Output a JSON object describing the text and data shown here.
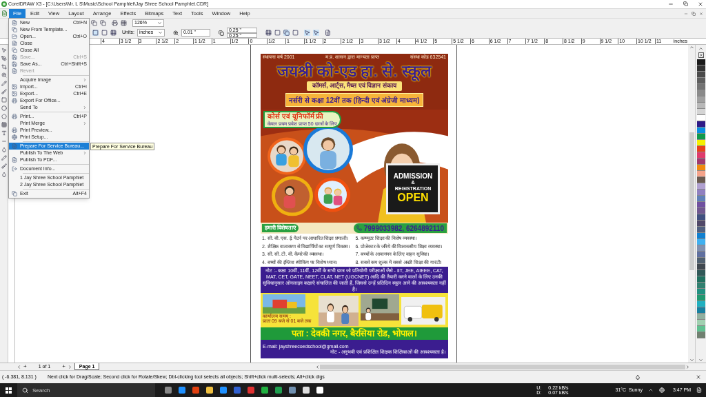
{
  "window": {
    "title": "CorelDRAW X3 - [C:\\Users\\Mr. L S\\Music\\School Pamphlet\\Jay Shree School Pamphlet.CDR]"
  },
  "menu_bar": [
    {
      "label": "File",
      "selected": true
    },
    {
      "label": "Edit",
      "selected": false
    },
    {
      "label": "View",
      "selected": false
    },
    {
      "label": "Layout",
      "selected": false
    },
    {
      "label": "Arrange",
      "selected": false
    },
    {
      "label": "Effects",
      "selected": false
    },
    {
      "label": "Bitmaps",
      "selected": false
    },
    {
      "label": "Text",
      "selected": false
    },
    {
      "label": "Tools",
      "selected": false
    },
    {
      "label": "Window",
      "selected": false
    },
    {
      "label": "Help",
      "selected": false
    }
  ],
  "file_menu": [
    {
      "kind": "item",
      "label": "New",
      "shortcut": "Ctrl+N",
      "icon": true,
      "disabled": false,
      "selected": false,
      "submenu": false
    },
    {
      "kind": "item",
      "label": "New From Template...",
      "icon": true,
      "disabled": false,
      "selected": false,
      "submenu": false
    },
    {
      "kind": "item",
      "label": "Open...",
      "shortcut": "Ctrl+O",
      "icon": true,
      "disabled": false,
      "selected": false,
      "submenu": false
    },
    {
      "kind": "item",
      "label": "Close",
      "icon": true,
      "disabled": false,
      "selected": false,
      "submenu": false
    },
    {
      "kind": "item",
      "label": "Close All",
      "icon": true,
      "disabled": false,
      "selected": false,
      "submenu": false
    },
    {
      "kind": "item",
      "label": "Save...",
      "shortcut": "Ctrl+S",
      "icon": true,
      "disabled": true,
      "selected": false,
      "submenu": false
    },
    {
      "kind": "item",
      "label": "Save As...",
      "shortcut": "Ctrl+Shift+S",
      "icon": true,
      "disabled": false,
      "selected": false,
      "submenu": false
    },
    {
      "kind": "item",
      "label": "Revert",
      "icon": true,
      "disabled": true,
      "selected": false,
      "submenu": false
    },
    {
      "kind": "separator"
    },
    {
      "kind": "item",
      "label": "Acquire Image",
      "icon": false,
      "disabled": false,
      "selected": false,
      "submenu": true
    },
    {
      "kind": "item",
      "label": "Import...",
      "shortcut": "Ctrl+I",
      "icon": true,
      "disabled": false,
      "selected": false,
      "submenu": false
    },
    {
      "kind": "item",
      "label": "Export...",
      "shortcut": "Ctrl+E",
      "icon": true,
      "disabled": false,
      "selected": false,
      "submenu": false
    },
    {
      "kind": "item",
      "label": "Export For Office...",
      "icon": true,
      "disabled": false,
      "selected": false,
      "submenu": false
    },
    {
      "kind": "item",
      "label": "Send To",
      "icon": false,
      "disabled": false,
      "selected": false,
      "submenu": true
    },
    {
      "kind": "separator"
    },
    {
      "kind": "item",
      "label": "Print...",
      "shortcut": "Ctrl+P",
      "icon": true,
      "disabled": false,
      "selected": false,
      "submenu": false
    },
    {
      "kind": "item",
      "label": "Print Merge",
      "icon": false,
      "disabled": false,
      "selected": false,
      "submenu": true
    },
    {
      "kind": "item",
      "label": "Print Preview...",
      "icon": true,
      "disabled": false,
      "selected": false,
      "submenu": false
    },
    {
      "kind": "item",
      "label": "Print Setup...",
      "icon": true,
      "disabled": false,
      "selected": false,
      "submenu": false
    },
    {
      "kind": "separator"
    },
    {
      "kind": "item",
      "label": "Prepare For Service Bureau...",
      "icon": true,
      "disabled": false,
      "selected": true,
      "submenu": false
    },
    {
      "kind": "item",
      "label": "Publish To The Web",
      "icon": false,
      "disabled": false,
      "selected": false,
      "submenu": true
    },
    {
      "kind": "item",
      "label": "Publish To PDF...",
      "icon": true,
      "disabled": false,
      "selected": false,
      "submenu": false
    },
    {
      "kind": "separator"
    },
    {
      "kind": "item",
      "label": "Document Info...",
      "icon": true,
      "disabled": false,
      "selected": false,
      "submenu": false
    },
    {
      "kind": "separator"
    },
    {
      "kind": "item",
      "label": "1 Jay Shree School Pamphlet",
      "icon": false,
      "disabled": false,
      "selected": false,
      "submenu": false
    },
    {
      "kind": "item",
      "label": "2 Jay Shree School Pamphlet",
      "icon": false,
      "disabled": false,
      "selected": false,
      "submenu": false
    },
    {
      "kind": "separator"
    },
    {
      "kind": "item",
      "label": "Exit",
      "shortcut": "Alt+F4",
      "icon": true,
      "disabled": false,
      "selected": false,
      "submenu": false
    }
  ],
  "tooltip": "Prepare For Service Bureau",
  "toolbar": {
    "zoom": "126%",
    "units_label": "Units:",
    "units": "inches",
    "nudge": "0.01 \"",
    "duplicate_x": "0.25 \"",
    "duplicate_y": "0.25 \""
  },
  "ruler": {
    "labels": [
      "4",
      "3 1/2",
      "3",
      "2 1/2",
      "2",
      "1 1/2",
      "1",
      "1/2",
      "0",
      "1/2",
      "1",
      "1 1/2",
      "2",
      "2 1/2",
      "3",
      "3 1/2",
      "4",
      "4 1/2",
      "5",
      "5 1/2",
      "6",
      "6 1/2",
      "7",
      "7 1/2",
      "8",
      "8 1/2",
      "9",
      "9 1/2",
      "10",
      "10 1/2",
      "11"
    ],
    "unit": "inches"
  },
  "poster": {
    "top_left": "स्थापना वर्ष 2001",
    "top_center": "म.प्र. शासन द्वारा मान्यता प्राप्त",
    "top_right": "संस्था कोड 632541",
    "title": "जयश्री को-एड हा. से. स्कूल",
    "faculties": "कॉमर्स, आर्ट्स, मैथ्स एवं विज्ञान संकाय",
    "classes": "नर्सरी से कक्षा 12वीं तक (हिन्दी एवं अंग्रेजी माध्यम)",
    "offer": "कोर्स एवं यूनिफॉर्म फ्री",
    "offer_note": "केवल प्रथम प्रवेश प्राप्त 50 छात्रों के लिए",
    "sign": [
      "ADMISSION",
      "&",
      "REGISTRATION",
      "OPEN"
    ],
    "features_title": "हमारी विशेषताएं",
    "phone": "7999033982, 6264892110",
    "features": [
      {
        "number": "1.",
        "text": "सी. बी. एस. ई. पैटर्न पर आधारित शिक्षा प्रणाली।"
      },
      {
        "number": "2.",
        "text": "शैक्षिक वातावरण से विद्यार्थियों का सम्पूर्ण विकास।"
      },
      {
        "number": "3.",
        "text": "सी. सी. टी. वी. कैमरे की व्यवस्था।"
      },
      {
        "number": "4.",
        "text": "बच्चों की इंग्लिश स्पीकिंग पर विशेष ध्यान।"
      },
      {
        "number": "5.",
        "text": "कम्प्यूटर शिक्षा की विशेष व्यवस्था।"
      },
      {
        "number": "6.",
        "text": "प्रोजेक्टर के जरिये की विश्वस्तरीय शिक्षा व्यवस्था।"
      },
      {
        "number": "7.",
        "text": "बच्चों के आवागमन के लिए वाहन सुविधा।"
      },
      {
        "number": "8.",
        "text": "सबसे कम शुल्क में सबसे अच्छी शिक्षा की गारंटी।"
      }
    ],
    "note": "नोट :- कक्षा 10वीं, 11वीं, 12वीं के सभी छात्र जो प्रतियोगी परीक्षाओं जैसे - IIT, JEE, AIEEE, CAT, MAT, CET, GATE, NEET, CLAT, NET (UGCNET) आदि की तैयारी करने वालों के लिए उनकी सुविधानुसार ऑनलाइन कक्षाएँ संचालित की जाती हैं, जिससे उन्हें प्रतिदिन स्कूल आने की आवश्यकता नहीं है।",
    "office_hours": [
      "कार्यालय समय :",
      "प्रातः 09 बजे से 01 बजे तक"
    ],
    "address": "पता : देवकी नगर, बैरसिया रोड, भोपाल।",
    "email": "E-mail: jayshreecoedschool@gmail.com",
    "vacancy": "नोट - अनुभवी एवं प्रशिक्षित शिक्षक शिक्षिकाओं की आवश्यकता है।"
  },
  "page_nav": {
    "add_before": "+",
    "count": "1 of 1",
    "add_after": "+",
    "tabs": [
      {
        "label": "Page 1",
        "selected": true
      }
    ]
  },
  "status_bar": {
    "coordinates": "( -6.381, 8.131 )",
    "hint": "Next click for Drag/Scale; Second click for Rotate/Skew; Dbl-clicking tool selects all objects; Shift+click multi-selects; Alt+click digs"
  },
  "palette": [
    {
      "color": "#1a1a1a"
    },
    {
      "color": "#333333"
    },
    {
      "color": "#4a4a4a"
    },
    {
      "color": "#5e5e5e"
    },
    {
      "color": "#737373"
    },
    {
      "color": "#8a8a8a"
    },
    {
      "color": "#a0a0a0"
    },
    {
      "color": "#b8b8b8"
    },
    {
      "color": "#d4d4d4"
    },
    {
      "color": "#ffffff"
    },
    {
      "color": "#2e1a87"
    },
    {
      "color": "#0a8fe0"
    },
    {
      "color": "#0f9a4c"
    },
    {
      "color": "#f5f000"
    },
    {
      "color": "#e8401c"
    },
    {
      "color": "#e03a6b"
    },
    {
      "color": "#a03a6f"
    },
    {
      "color": "#f08a10"
    },
    {
      "color": "#f5a38a"
    },
    {
      "color": "#6a5a50"
    },
    {
      "color": "#b0a0d0"
    },
    {
      "color": "#9080c0"
    },
    {
      "color": "#6080b8"
    },
    {
      "color": "#7050a0"
    },
    {
      "color": "#705890"
    },
    {
      "color": "#405080"
    },
    {
      "color": "#504868"
    },
    {
      "color": "#506080"
    },
    {
      "color": "#1080d0"
    },
    {
      "color": "#40b0f0"
    },
    {
      "color": "#8090b0"
    },
    {
      "color": "#6070a0"
    },
    {
      "color": "#506070"
    },
    {
      "color": "#404850"
    },
    {
      "color": "#305858"
    },
    {
      "color": "#207060"
    },
    {
      "color": "#308070"
    },
    {
      "color": "#209080"
    },
    {
      "color": "#209870"
    },
    {
      "color": "#20b0c0"
    },
    {
      "color": "#1880a0"
    },
    {
      "color": "#90b0a0"
    },
    {
      "color": "#a0d0b0"
    },
    {
      "color": "#60c090"
    },
    {
      "color": "#708070"
    }
  ],
  "taskbar": {
    "search_placeholder": "Search",
    "upload_label": "U:",
    "upload": "0.22 kB/s",
    "download_label": "D:",
    "download": "0.07 kB/s",
    "weather": "31°C  Sunny",
    "time": "3:47 PM"
  }
}
